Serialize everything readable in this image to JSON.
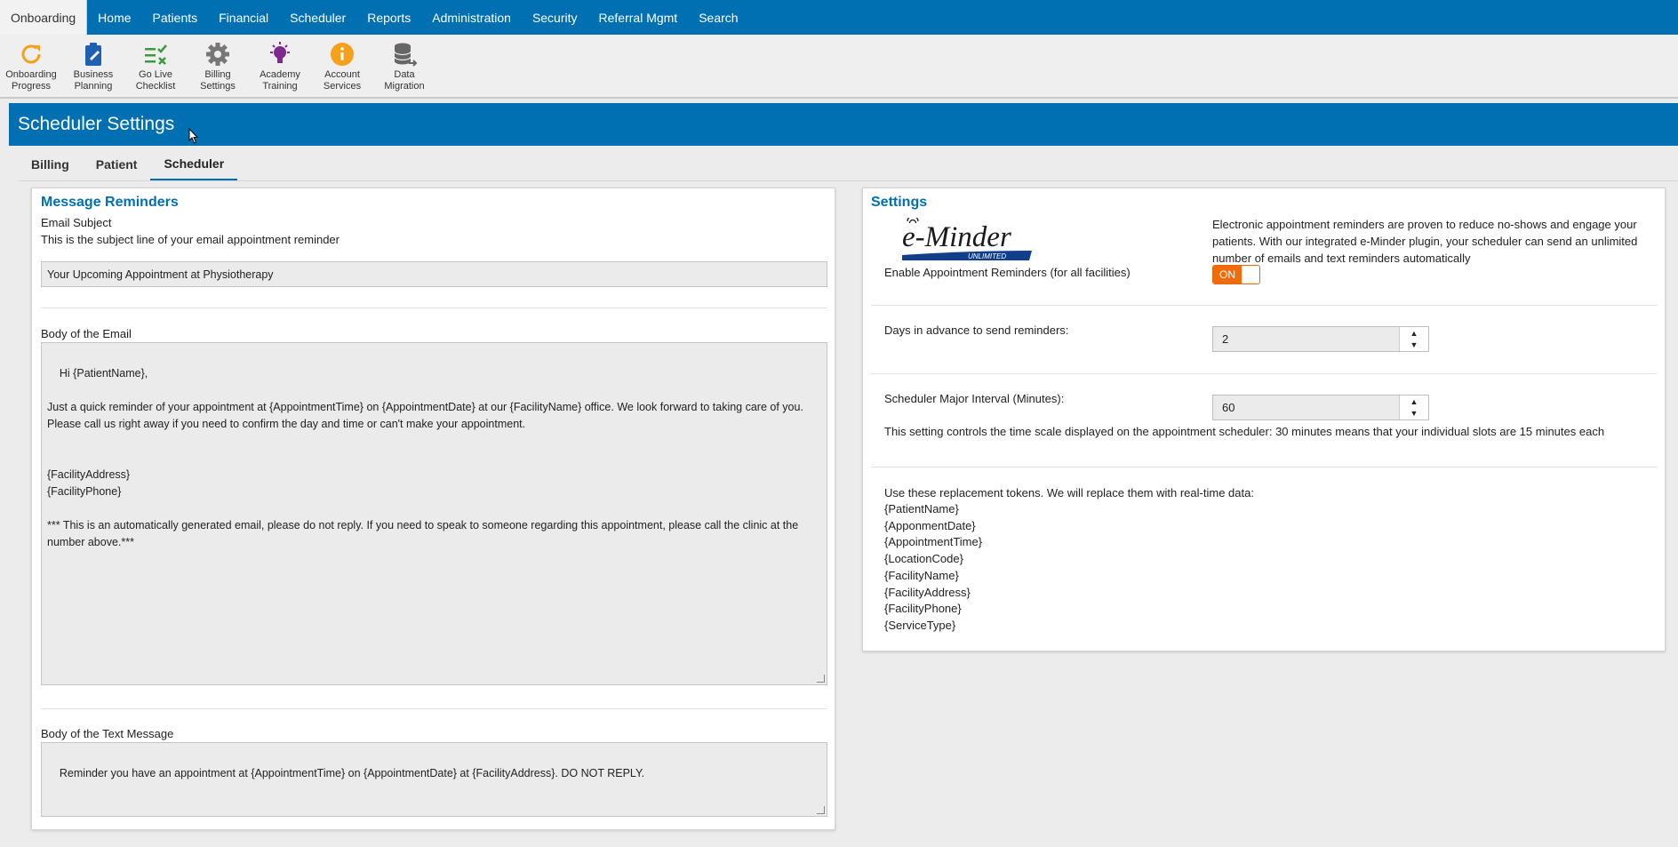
{
  "topnav": {
    "items": [
      "Onboarding",
      "Home",
      "Patients",
      "Financial",
      "Scheduler",
      "Reports",
      "Administration",
      "Security",
      "Referral Mgmt",
      "Search"
    ]
  },
  "toolbar": {
    "items": [
      {
        "label": "Onboarding\nProgress",
        "icon": "refresh-icon"
      },
      {
        "label": "Business\nPlanning",
        "icon": "clipboard-icon"
      },
      {
        "label": "Go Live\nChecklist",
        "icon": "checklist-icon"
      },
      {
        "label": "Billing\nSettings",
        "icon": "gear-icon"
      },
      {
        "label": "Academy\nTraining",
        "icon": "lightbulb-icon"
      },
      {
        "label": "Account\nServices",
        "icon": "info-icon"
      },
      {
        "label": "Data\nMigration",
        "icon": "database-icon"
      }
    ]
  },
  "page": {
    "title": "Scheduler Settings"
  },
  "tabs": [
    "Billing",
    "Patient",
    "Scheduler"
  ],
  "colors": {
    "primary": "#0070b2",
    "accent": "#f26b0b"
  },
  "message_reminders": {
    "title": "Message Reminders",
    "email_subject_label": "Email Subject",
    "email_subject_help": "This is the subject line of your email appointment reminder",
    "email_subject_value": "Your Upcoming Appointment at Physiotherapy",
    "email_body_label": "Body of the Email",
    "email_body_value": "Hi {PatientName},\n\nJust a quick reminder of your appointment at {AppointmentTime} on {AppointmentDate} at our {FacilityName} office. We look forward to taking care of you. Please call us right away if you need to confirm the day and time or can't make your appointment.\n\n\n{FacilityAddress}\n{FacilityPhone}\n\n*** This is an automatically generated email, please do not reply. If you need to speak to someone regarding this appointment, please call the clinic at the number above.***",
    "text_body_label": "Body of the Text Message",
    "text_body_value": "Reminder you have an appointment at {AppointmentTime} on {AppointmentDate} at {FacilityAddress}. DO NOT REPLY."
  },
  "settings": {
    "title": "Settings",
    "logo_text": "e-Minder",
    "logo_sub": "UNLIMITED",
    "enable_label": "Enable Appointment Reminders (for all facilities)",
    "description": "Electronic appointment reminders are proven to reduce no-shows and engage your patients. With our integrated e-Minder plugin, your scheduler can send an unlimited number of emails and text reminders automatically",
    "toggle_label": "ON",
    "days_label": "Days in advance to send reminders:",
    "days_value": "2",
    "interval_label": "Scheduler Major Interval (Minutes):",
    "interval_value": "60",
    "interval_help": "This setting controls the time scale displayed on the appointment scheduler: 30 minutes means that your individual slots are 15 minutes each",
    "tokens_intro": "Use these replacement tokens. We will replace them with real-time data:",
    "tokens": [
      "{PatientName}",
      "{ApponmentDate}",
      "{AppointmentTime}",
      "{LocationCode}",
      "{FacilityName}",
      "{FacilityAddress}",
      "{FacilityPhone}",
      "{ServiceType}"
    ]
  }
}
